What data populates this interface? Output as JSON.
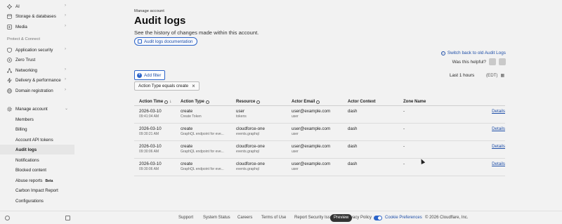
{
  "sidebar": {
    "top_items": [
      {
        "label": "AI",
        "icon": "ai-icon"
      },
      {
        "label": "Storage & databases",
        "icon": "database-icon"
      },
      {
        "label": "Media",
        "icon": "media-icon"
      }
    ],
    "section_protect": "Protect & Connect",
    "protect_items": [
      {
        "label": "Application security",
        "icon": "shield-icon"
      },
      {
        "label": "Zero Trust",
        "icon": "zero-trust-icon"
      },
      {
        "label": "Networking",
        "icon": "network-icon"
      },
      {
        "label": "Delivery & performance",
        "icon": "lightning-icon"
      },
      {
        "label": "Domain registration",
        "icon": "globe-icon"
      }
    ],
    "manage_account": {
      "label": "Manage account",
      "icon": "gear-icon"
    },
    "manage_sub": [
      "Members",
      "Billing",
      "Account API tokens",
      "Audit logs",
      "Notifications",
      "Blocked content",
      "Abuse reports",
      "Carbon Impact Report",
      "Configurations"
    ],
    "beta_badge": "Beta"
  },
  "header": {
    "eyebrow": "Manage account",
    "title": "Audit logs",
    "subtitle": "See the history of changes made within this account.",
    "doc_button": "Audit logs documentation",
    "switch_link": "Switch back to old Audit Logs",
    "helpful": "Was this helpful?"
  },
  "filters": {
    "add_filter": "Add filter",
    "time_range": "Last 1 hours",
    "timezone": "(EDT)",
    "chip": "Action Type equals create"
  },
  "table": {
    "headers": [
      "Action Time",
      "Action Type",
      "Resource",
      "Actor Email",
      "Actor Context",
      "Zone Name"
    ],
    "rows": [
      {
        "date": "2026-03-10",
        "time": "09:41:04 AM",
        "action": "create",
        "action_sub": "Create Token",
        "resource": "user",
        "resource_sub": "tokens",
        "email": "user@example.com",
        "email_sub": "user",
        "context": "dash",
        "zone": "-",
        "details": "Details"
      },
      {
        "date": "2026-03-10",
        "time": "09:30:21 AM",
        "action": "create",
        "action_sub": "GraphQL endpoint for eve...",
        "resource": "cloudforce-one",
        "resource_sub": "events.graphql",
        "email": "user@example.com",
        "email_sub": "user",
        "context": "dash",
        "zone": "-",
        "details": "Details"
      },
      {
        "date": "2026-03-10",
        "time": "09:30:06 AM",
        "action": "create",
        "action_sub": "GraphQL endpoint for eve...",
        "resource": "cloudforce-one",
        "resource_sub": "events.graphql",
        "email": "user@example.com",
        "email_sub": "user",
        "context": "dash",
        "zone": "-",
        "details": "Details"
      },
      {
        "date": "2026-03-10",
        "time": "09:30:06 AM",
        "action": "create",
        "action_sub": "GraphQL endpoint for eve...",
        "resource": "cloudforce-one",
        "resource_sub": "events.graphql",
        "email": "user@example.com",
        "email_sub": "user",
        "context": "dash",
        "zone": "-",
        "details": "Details"
      }
    ]
  },
  "footer": {
    "links": [
      "Support",
      "System Status",
      "Careers",
      "Terms of Use",
      "Report Security Issu",
      "vacy Policy",
      "Cookie Preferences",
      "© 2026 Cloudflare, Inc."
    ],
    "preview": "Preview"
  },
  "colors": {
    "accent": "#2c64c9",
    "link": "#1f4fa8",
    "background": "#f2f2f2"
  }
}
